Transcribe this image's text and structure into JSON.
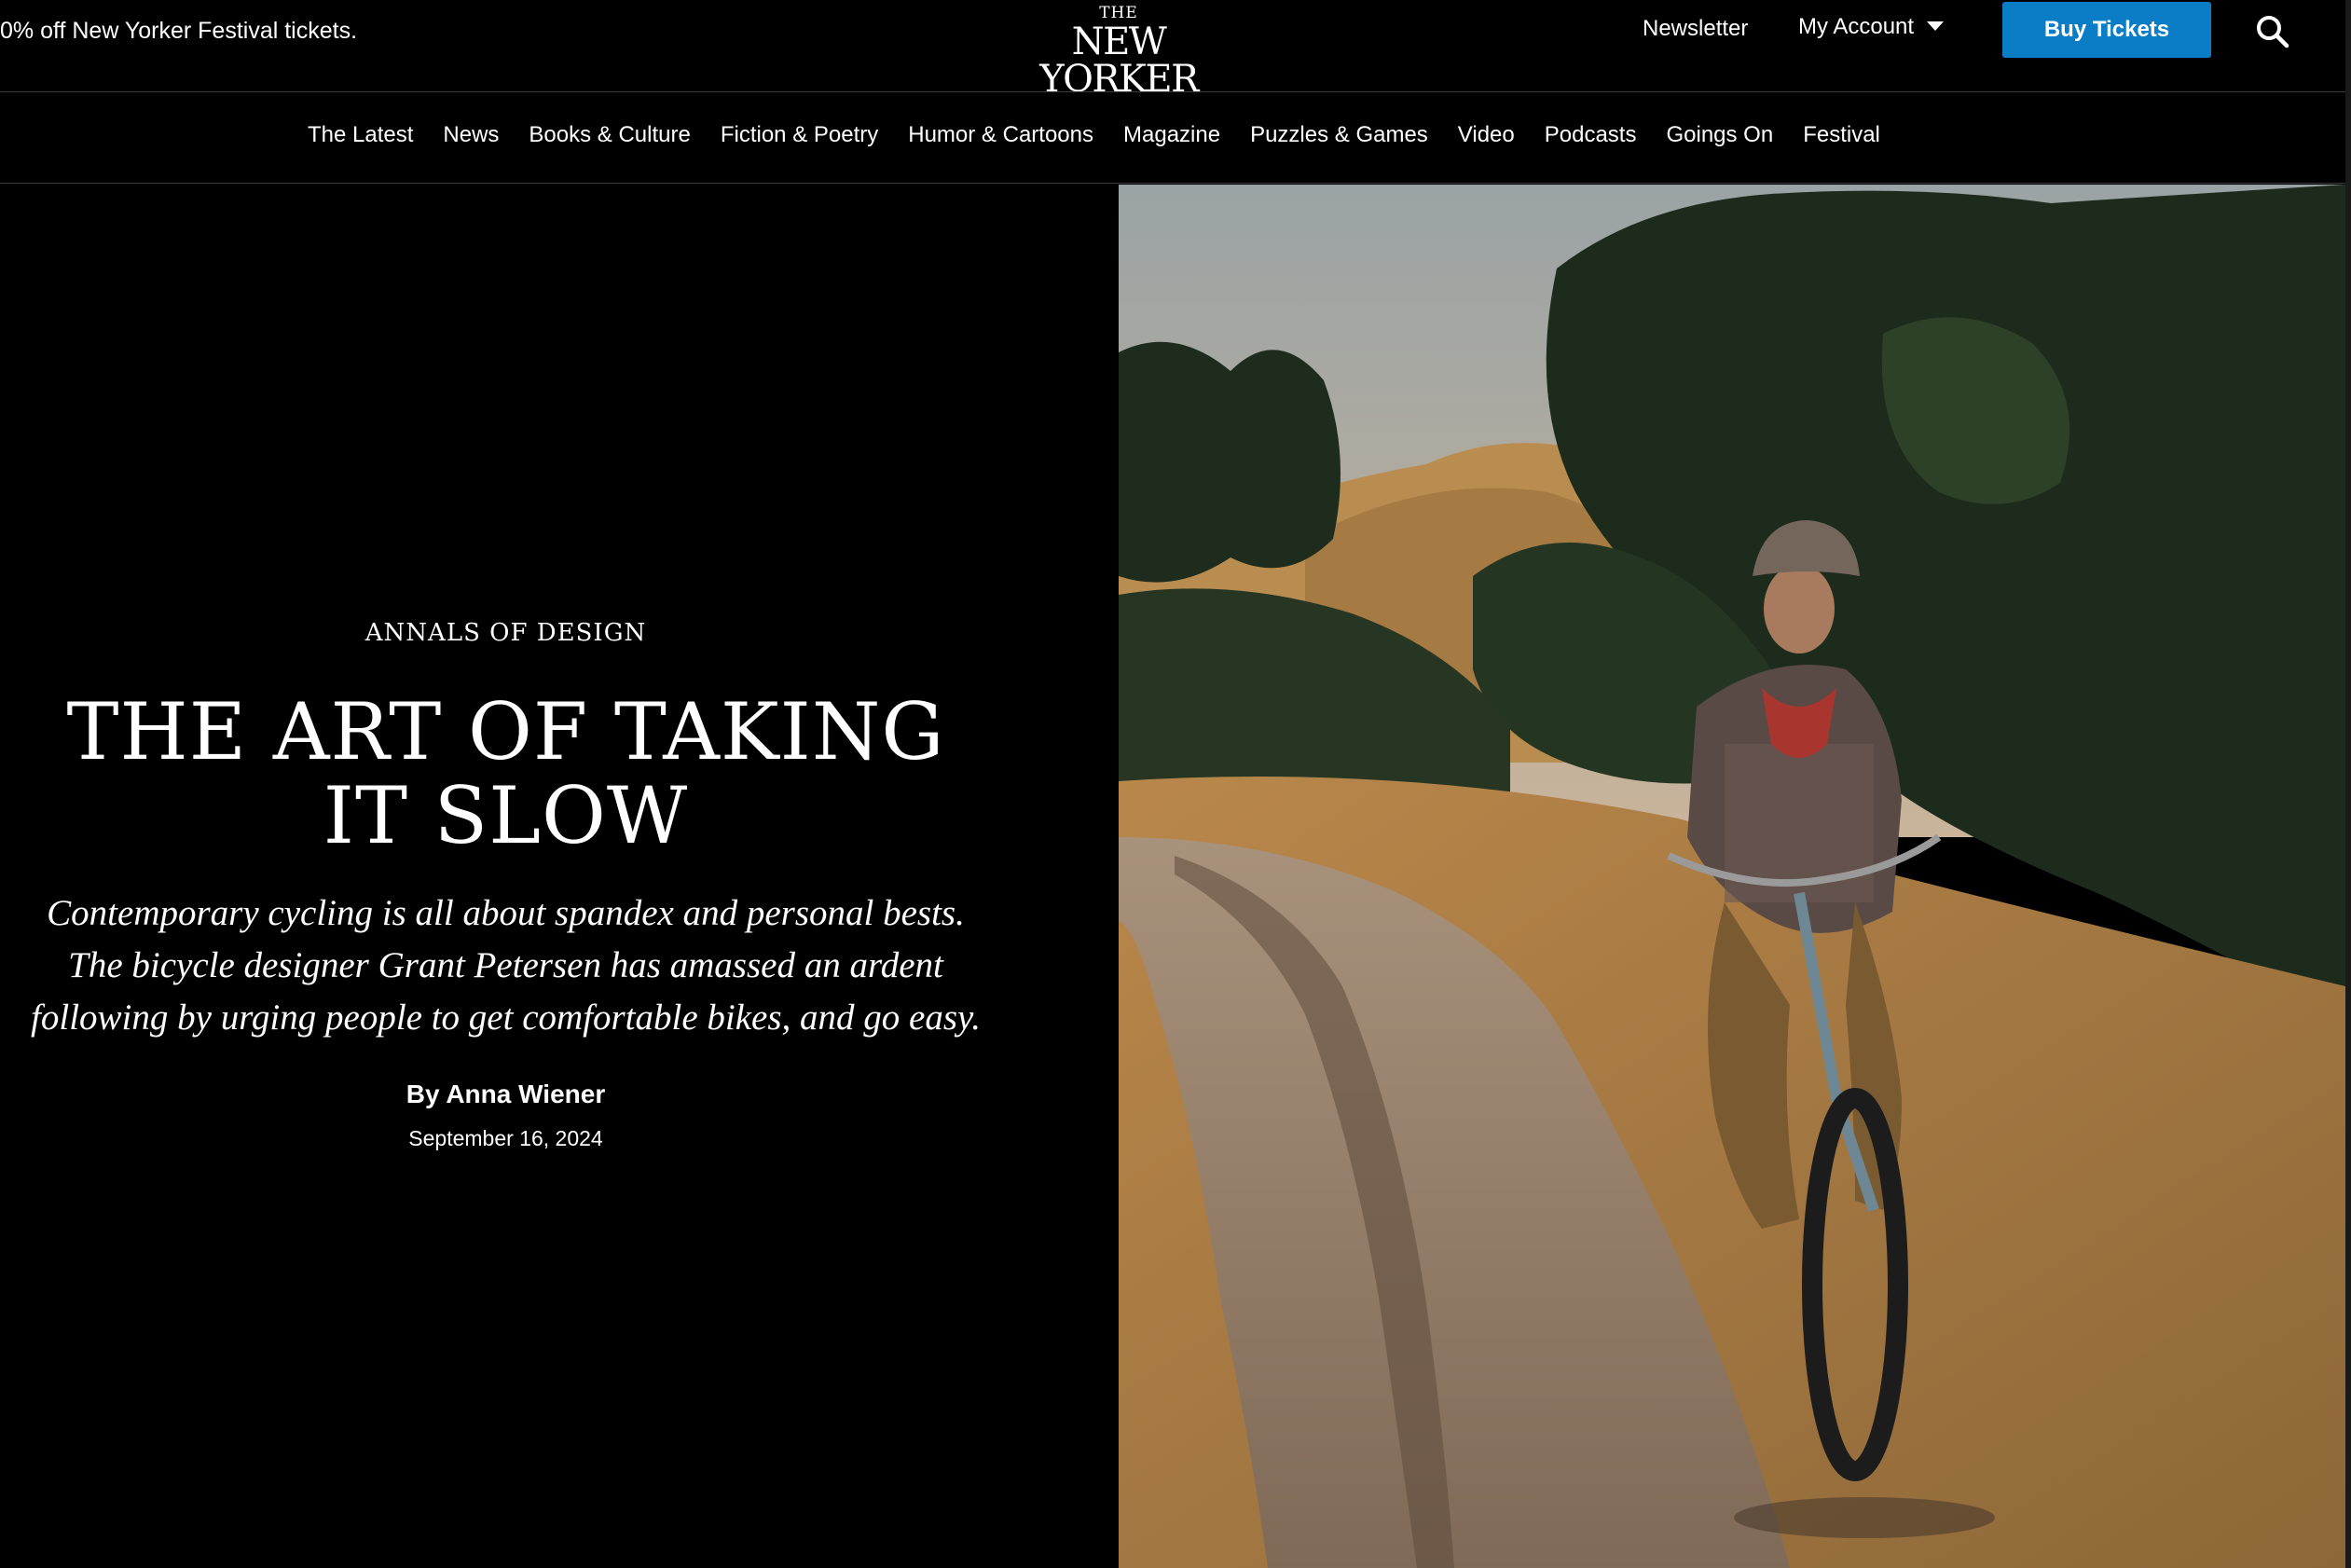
{
  "promo": {
    "text": "0% off New Yorker Festival tickets."
  },
  "logo": {
    "the": "THE",
    "main": "NEW YORKER"
  },
  "header": {
    "newsletter": "Newsletter",
    "account": "My Account",
    "buy_tickets": "Buy Tickets",
    "search_icon": "search-icon",
    "accent_color": "#0b7dc6"
  },
  "nav": {
    "items": [
      {
        "label": "The Latest"
      },
      {
        "label": "News"
      },
      {
        "label": "Books & Culture"
      },
      {
        "label": "Fiction & Poetry"
      },
      {
        "label": "Humor & Cartoons"
      },
      {
        "label": "Magazine"
      },
      {
        "label": "Puzzles & Games"
      },
      {
        "label": "Video"
      },
      {
        "label": "Podcasts"
      },
      {
        "label": "Goings On"
      },
      {
        "label": "Festival"
      }
    ]
  },
  "article": {
    "rubric": "Annals of Design",
    "headline": "The Art of Taking It Slow",
    "dek": "Contemporary cycling is all about spandex and personal bests. The bicycle designer Grant Petersen has amassed an ardent following by urging people to get comfortable bikes, and go easy.",
    "byline_prefix": "By",
    "author": "Anna Wiener",
    "date": "September 16, 2024"
  }
}
